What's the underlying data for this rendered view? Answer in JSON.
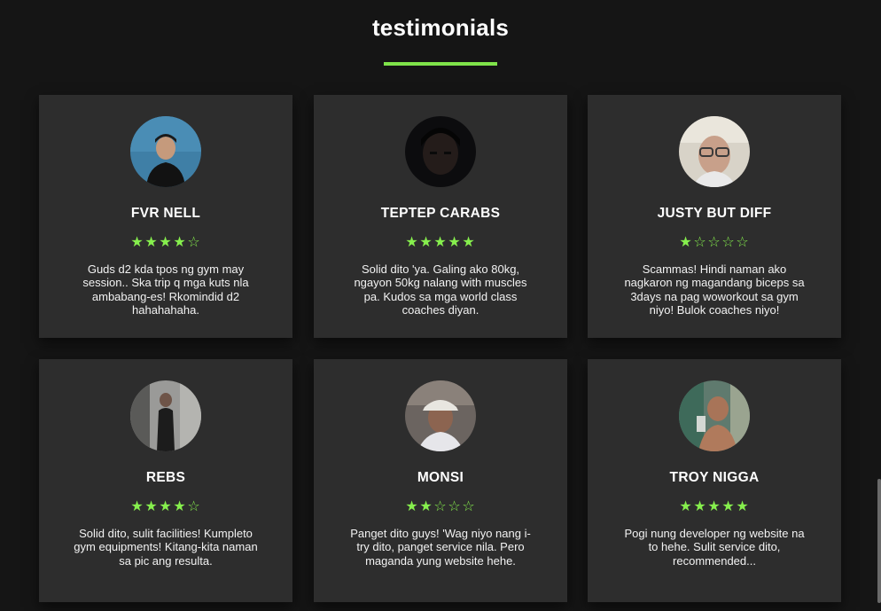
{
  "section": {
    "title": "testimonials",
    "accent_color": "#7fe34a"
  },
  "testimonials": [
    {
      "name": "FVR NELL",
      "rating": 4,
      "max_rating": 5,
      "avatar_icon": "person-avatar-photo",
      "text": "Guds d2 kda tpos ng gym may session.. Ska trip q mga kuts nla ambabang-es! Rkomindid d2 hahahahaha."
    },
    {
      "name": "TEPTEP CARABS",
      "rating": 5,
      "max_rating": 5,
      "avatar_icon": "person-avatar-photo",
      "text": "Solid dito 'ya. Galing ako 80kg, ngayon 50kg nalang with muscles pa. Kudos sa mga world class coaches diyan."
    },
    {
      "name": "JUSTY BUT DIFF",
      "rating": 1,
      "max_rating": 5,
      "avatar_icon": "person-avatar-photo",
      "text": "Scammas! Hindi naman ako nagkaron ng magandang biceps sa 3days na pag woworkout sa gym niyo! Bulok coaches niyo!"
    },
    {
      "name": "REBS",
      "rating": 4,
      "max_rating": 5,
      "avatar_icon": "person-avatar-photo",
      "text": "Solid dito, sulit facilities! Kumpleto gym equipments! Kitang-kita naman sa pic ang resulta."
    },
    {
      "name": "MONSI",
      "rating": 2,
      "max_rating": 5,
      "avatar_icon": "person-avatar-photo",
      "text": "Panget dito guys! 'Wag niyo nang i-try dito, panget service nila. Pero maganda yung website hehe."
    },
    {
      "name": "TROY NIGGA",
      "rating": 5,
      "max_rating": 5,
      "avatar_icon": "person-avatar-photo",
      "text": "Pogi nung developer ng website na to hehe. Sulit service dito, recommended..."
    }
  ]
}
